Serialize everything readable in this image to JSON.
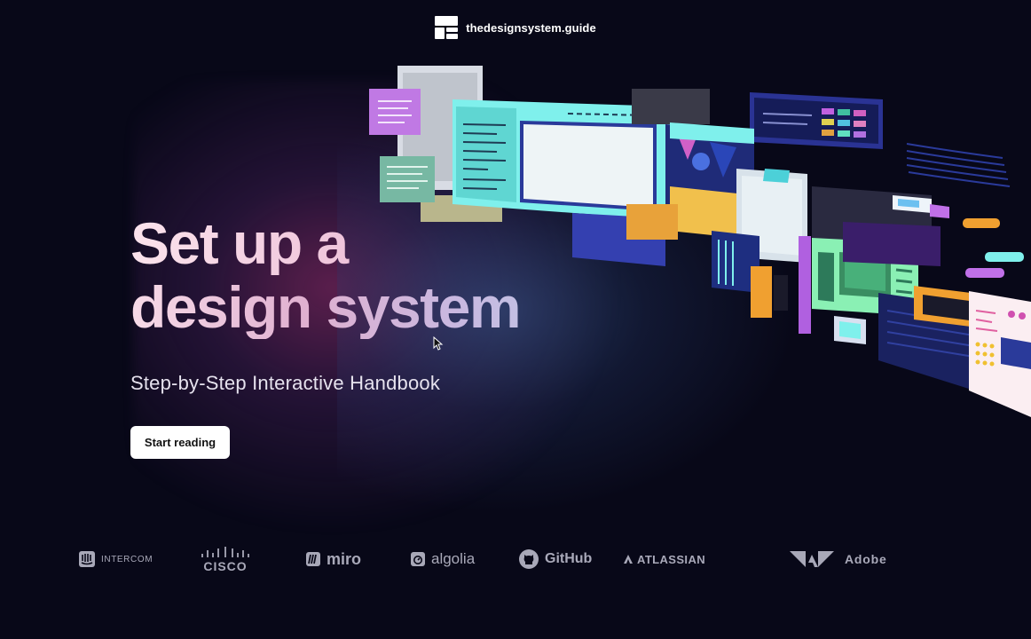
{
  "header": {
    "site_name": "thedesignsystem.guide",
    "logo_icon": "layout-blocks-icon"
  },
  "hero": {
    "title_line1": "Set up a",
    "title_line2": "design system",
    "subtitle": "Step-by-Step Interactive Handbook",
    "cta_label": "Start reading"
  },
  "logos": [
    {
      "name": "INTERCOM",
      "icon": "intercom-icon"
    },
    {
      "name": "CISCO",
      "icon": "cisco-icon"
    },
    {
      "name": "miro",
      "icon": "miro-icon"
    },
    {
      "name": "algolia",
      "icon": "algolia-icon"
    },
    {
      "name": "GitHub",
      "icon": "github-icon"
    },
    {
      "name": "ATLASSIAN",
      "icon": "atlassian-icon"
    },
    {
      "name": "Adobe",
      "icon": "adobe-icon"
    }
  ],
  "colors": {
    "background": "#080818",
    "cta_background": "#ffffff",
    "accent_pink": "#c46aa8",
    "accent_cyan": "#7ff0ec",
    "accent_purple": "#a070e8",
    "accent_orange": "#f0a030"
  }
}
